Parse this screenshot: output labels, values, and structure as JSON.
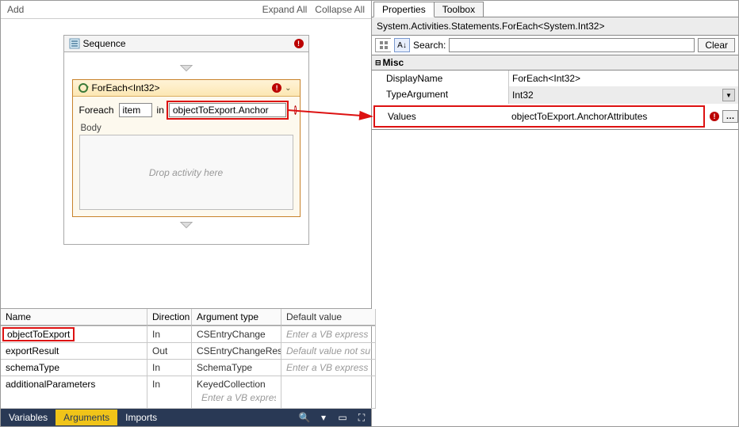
{
  "toolbar": {
    "add": "Add",
    "expand_all": "Expand All",
    "collapse_all": "Collapse All"
  },
  "sequence": {
    "title": "Sequence",
    "foreach_title": "ForEach<Int32>",
    "foreach_label": "Foreach",
    "item_value": "item",
    "in_label": "in",
    "expr_value": "objectToExport.Anchor",
    "body_label": "Body",
    "drop_hint": "Drop activity here"
  },
  "arguments": {
    "headers": {
      "name": "Name",
      "direction": "Direction",
      "type": "Argument type",
      "def": "Default value"
    },
    "rows": [
      {
        "name": "objectToExport",
        "dir": "In",
        "type": "CSEntryChange",
        "def": "Enter a VB express",
        "hl": true
      },
      {
        "name": "exportResult",
        "dir": "Out",
        "type": "CSEntryChangeRes",
        "def": "Default value not su"
      },
      {
        "name": "schemaType",
        "dir": "In",
        "type": "SchemaType",
        "def": "Enter a VB express"
      },
      {
        "name": "additionalParameters",
        "dir": "In",
        "type": "KeyedCollection<S",
        "def": "Enter a VB express"
      }
    ]
  },
  "bottom_tabs": {
    "variables": "Variables",
    "arguments": "Arguments",
    "imports": "Imports"
  },
  "prop_tabs": {
    "properties": "Properties",
    "toolbox": "Toolbox"
  },
  "prop_header": "System.Activities.Statements.ForEach<System.Int32>",
  "search": {
    "label": "Search:",
    "clear": "Clear"
  },
  "misc_label": "Misc",
  "props": {
    "display_name_k": "DisplayName",
    "display_name_v": "ForEach<Int32>",
    "type_arg_k": "TypeArgument",
    "type_arg_v": "Int32",
    "values_k": "Values",
    "values_v": "objectToExport.AnchorAttributes"
  }
}
